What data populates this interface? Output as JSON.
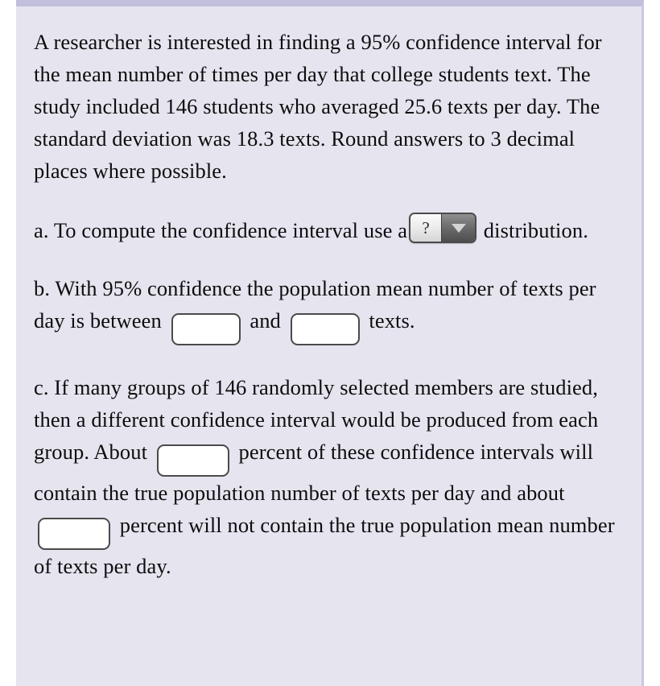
{
  "panel": {
    "background_color": "#e6e4ef",
    "top_border_color": "#c2bfdc"
  },
  "problem": {
    "intro": "A researcher is interested in finding a 95% confidence interval for the mean number of times per day that college students text. The study included 146 students who averaged 25.6 texts per day. The standard deviation was 18.3 texts. Round answers to 3 decimal places where possible.",
    "confidence_level": "95%",
    "sample_size": "146",
    "sample_mean": "25.6",
    "standard_deviation": "18.3",
    "rounding": "3 decimal places"
  },
  "part_a": {
    "label": "a.",
    "text_before": "a. To compute the confidence interval use a",
    "text_after": "distribution.",
    "distribution_select": {
      "value": "?",
      "placeholder": "?",
      "arrow_icon": "chevron-down-icon",
      "options": [
        "?"
      ]
    }
  },
  "part_b": {
    "label": "b.",
    "text_before": "b. With 95% confidence the population mean number of texts per day is between",
    "text_middle": "and",
    "text_after": "texts.",
    "lower_bound": {
      "value": "",
      "placeholder": ""
    },
    "upper_bound": {
      "value": "",
      "placeholder": ""
    }
  },
  "part_c": {
    "label": "c.",
    "text_1": "c. If many groups of 146 randomly selected members are studied, then a different confidence interval would be produced from each group. About",
    "text_2": "percent of these confidence intervals will contain the true population number of texts per day and about",
    "text_3": "percent will not contain the true population mean number of texts per day.",
    "contain_percent": {
      "value": "",
      "placeholder": ""
    },
    "not_contain_percent": {
      "value": "",
      "placeholder": ""
    }
  }
}
